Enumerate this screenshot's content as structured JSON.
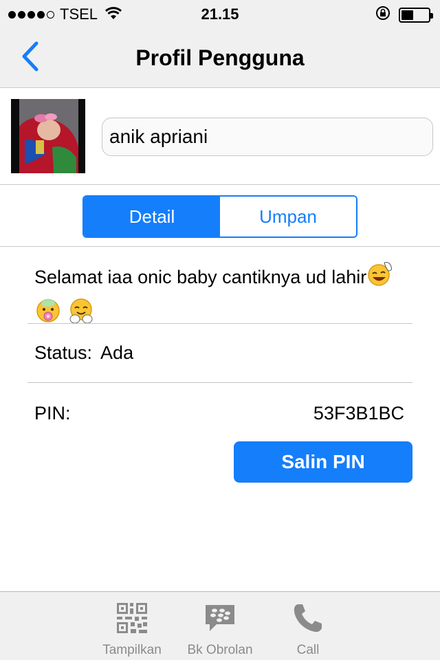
{
  "status_bar": {
    "carrier": "TSEL",
    "time": "21.15",
    "signal_bars": 4,
    "battery_level": 0.45
  },
  "nav": {
    "back_icon": "chevron-left-icon",
    "title": "Profil Pengguna"
  },
  "profile": {
    "name": "anik apriani"
  },
  "segments": {
    "detail": "Detail",
    "feed": "Umpan",
    "selected": "Detail"
  },
  "detail": {
    "message": "Selamat iaa onic baby cantiknya ud lahir",
    "message_emoji": [
      "laughing-wave-emoji",
      "baby-pacifier-emoji",
      "happy-hands-emoji"
    ],
    "status_label": "Status:",
    "status_value": "Ada",
    "pin_label": "PIN:",
    "pin_value": "53F3B1BC",
    "copy_button": "Salin PIN"
  },
  "tabbar": {
    "items": [
      {
        "label": "Tampilkan",
        "icon": "qr-code-icon"
      },
      {
        "label": "Bk Obrolan",
        "icon": "bbm-chat-icon"
      },
      {
        "label": "Call",
        "icon": "phone-icon"
      }
    ]
  },
  "colors": {
    "accent": "#157efb",
    "bar_background": "#f0f0f0",
    "tab_icon_gray": "#8b8b8b"
  }
}
